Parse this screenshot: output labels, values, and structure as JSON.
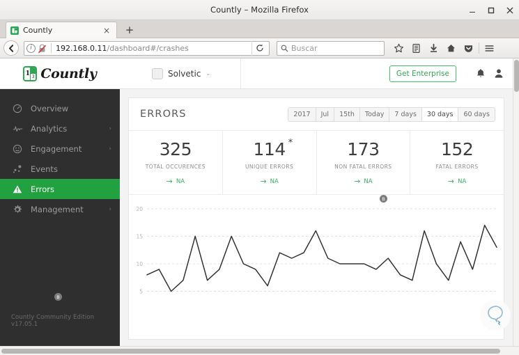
{
  "browser": {
    "window_title": "Countly – Mozilla Firefox",
    "minimize_label": "Minimize",
    "maximize_label": "Maximize",
    "close_label": "Close",
    "tab": {
      "title": "Countly",
      "favicon": "countly-favicon",
      "close_label": "×"
    },
    "new_tab_label": "+",
    "back_label": "←",
    "identity_label": "i",
    "url_host": "192.168.0.11",
    "url_path": "/dashboard#/crashes",
    "reload_label": "⟳",
    "search_placeholder": "Buscar",
    "toolbar_icons": [
      "bookmark-star-icon",
      "library-icon",
      "downloads-icon",
      "home-icon",
      "pocket-icon",
      "menu-icon"
    ]
  },
  "sidebar": {
    "logo_text": "Countly",
    "logo_digit": "1",
    "logo_fraction": "3",
    "items": [
      {
        "label": "Overview",
        "icon": "gauge-icon",
        "active": false,
        "has_chevron": false
      },
      {
        "label": "Analytics",
        "icon": "pulse-icon",
        "active": false,
        "has_chevron": true
      },
      {
        "label": "Engagement",
        "icon": "smiley-icon",
        "active": false,
        "has_chevron": true
      },
      {
        "label": "Events",
        "icon": "events-dots-icon",
        "active": false,
        "has_chevron": false
      },
      {
        "label": "Errors",
        "icon": "warning-triangle-icon",
        "active": true,
        "has_chevron": false
      },
      {
        "label": "Management",
        "icon": "gear-icon",
        "active": false,
        "has_chevron": true
      }
    ],
    "footer": "Countly Community Edition v17.05.1"
  },
  "appbar": {
    "app_name": "Solvetic",
    "app_caret": "⌄",
    "enterprise_button": "Get Enterprise",
    "bell_label": "Notifications",
    "user_label": "Account"
  },
  "main": {
    "panel_title": "ERRORS",
    "date_filter": [
      {
        "label": "2017",
        "active": false
      },
      {
        "label": "Jul",
        "active": false
      },
      {
        "label": "15th",
        "active": false
      },
      {
        "label": "Today",
        "active": false
      },
      {
        "label": "7 days",
        "active": false
      },
      {
        "label": "30 days",
        "active": true
      },
      {
        "label": "60 days",
        "active": false
      }
    ],
    "stats": [
      {
        "value": "325",
        "sup": "",
        "label": "TOTAL OCCURENCES",
        "trend": "NA",
        "trend_arrow": "→"
      },
      {
        "value": "114",
        "sup": "*",
        "label": "UNIQUE ERRORS",
        "trend": "NA",
        "trend_arrow": "→"
      },
      {
        "value": "173",
        "sup": "",
        "label": "NON FATAL ERRORS",
        "trend": "NA",
        "trend_arrow": "→"
      },
      {
        "value": "152",
        "sup": "",
        "label": "FATAL ERRORS",
        "trend": "NA",
        "trend_arrow": "→"
      }
    ],
    "markers": [
      {
        "label": "B",
        "x": 256,
        "y": 427,
        "name": "chart-annotation-marker-left"
      },
      {
        "label": "B",
        "x": 723,
        "y": 286,
        "name": "chart-annotation-marker-right"
      }
    ],
    "feedback_icon": "speech-bubble-icon"
  },
  "chart_data": {
    "type": "line",
    "title": "",
    "xlabel": "",
    "ylabel": "",
    "grid": true,
    "legend": false,
    "ylim": [
      0,
      21
    ],
    "yticks": [
      5,
      10,
      15,
      20
    ],
    "ytick_labels": [
      "5",
      "10",
      "15",
      "20"
    ],
    "line_color": "#333333",
    "x": [
      1,
      2,
      3,
      4,
      5,
      6,
      7,
      8,
      9,
      10,
      11,
      12,
      13,
      14,
      15,
      16,
      17,
      18,
      19,
      20,
      21,
      22,
      23,
      24,
      25,
      26,
      27,
      28,
      29,
      30
    ],
    "series": [
      {
        "name": "Errors",
        "values": [
          8,
          9,
          5,
          7,
          15,
          7,
          9,
          15,
          10,
          9,
          6,
          12,
          11,
          12,
          16,
          11,
          10,
          10,
          10,
          9,
          11,
          8,
          7,
          16,
          10,
          7,
          14,
          9,
          17,
          13
        ]
      }
    ]
  }
}
